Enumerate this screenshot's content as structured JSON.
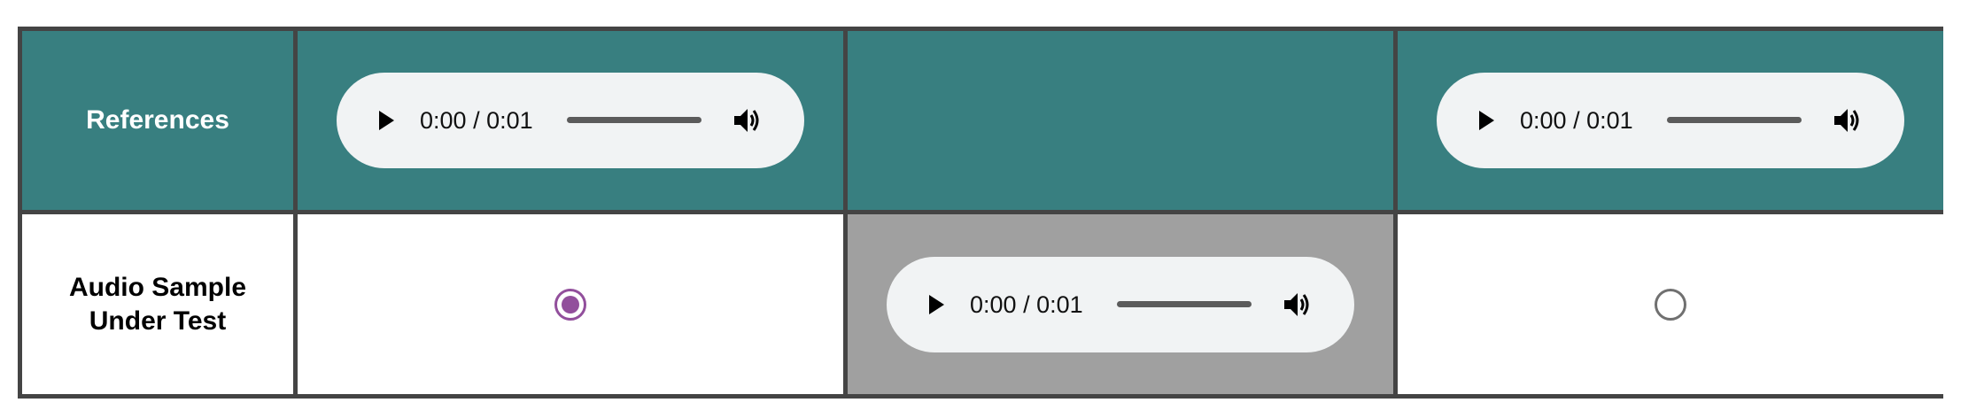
{
  "header_row": {
    "label": "References",
    "players": [
      {
        "time": "0:00",
        "separator": " / ",
        "duration": "0:01"
      },
      null,
      {
        "time": "0:00",
        "separator": " / ",
        "duration": "0:01"
      }
    ]
  },
  "test_row": {
    "label_line1": "Audio Sample",
    "label_line2": "Under Test",
    "options": [
      {
        "type": "radio",
        "checked": true
      },
      {
        "type": "player",
        "time": "0:00",
        "separator": " / ",
        "duration": "0:01"
      },
      {
        "type": "radio",
        "checked": false
      }
    ]
  },
  "colors": {
    "header_bg": "#387f80",
    "selected_bg": "#a0a0a0",
    "grid_border": "#444444",
    "player_bg": "#f1f3f4",
    "radio_checked": "#924f9c",
    "radio_unchecked": "#707070"
  },
  "icons": {
    "play": "play-icon",
    "volume": "volume-icon"
  }
}
